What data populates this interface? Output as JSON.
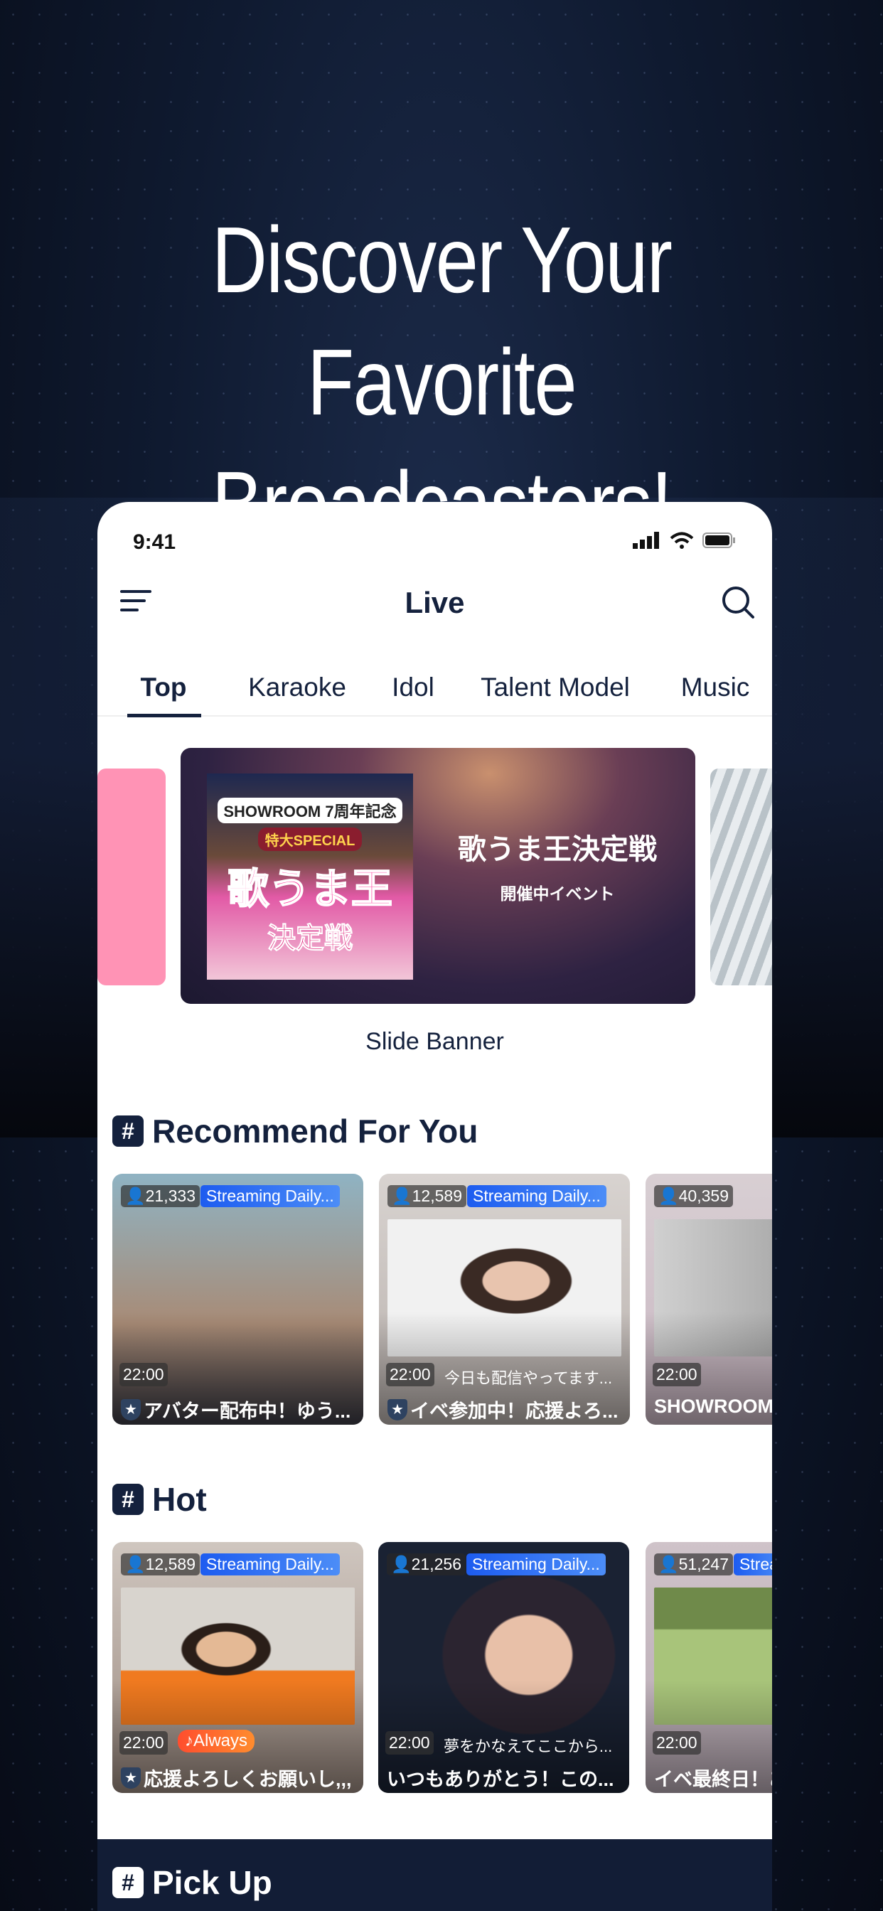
{
  "headline": {
    "line1": "Discover Your Favorite",
    "line2": "Broadcasters!"
  },
  "status": {
    "time": "9:41"
  },
  "nav": {
    "title": "Live",
    "menu_icon": "hamburger-icon",
    "search_icon": "search-icon"
  },
  "tabs": [
    {
      "label": "Top",
      "active": true
    },
    {
      "label": "Karaoke"
    },
    {
      "label": "Idol"
    },
    {
      "label": "Talent Model"
    },
    {
      "label": "Music"
    }
  ],
  "banner": {
    "poster_line1": "SHOWROOM 7周年記念",
    "poster_line2": "特大SPECIAL",
    "poster_line3": "歌うま王",
    "poster_line4": "決定戦",
    "title": "歌うま王決定戦",
    "subtitle": "開催中イベント",
    "label": "Slide Banner",
    "side_left_color": "#ff93b5"
  },
  "recommend": {
    "heading": "Recommend For You",
    "cards": [
      {
        "viewers": "21,333",
        "tag": "Streaming Daily...",
        "time": "22:00",
        "sub": "",
        "title": "アバター配布中！ゆう...",
        "star": true
      },
      {
        "viewers": "12,589",
        "tag": "Streaming Daily...",
        "time": "22:00",
        "sub": "今日も配信やってます...",
        "title": "イベ参加中！応援よろ...",
        "star": true
      },
      {
        "viewers": "40,359",
        "tag": "",
        "time": "22:00",
        "sub": "",
        "title": "SHOWROOM",
        "star": false
      }
    ]
  },
  "hot": {
    "heading": "Hot",
    "cards": [
      {
        "viewers": "12,589",
        "tag": "Streaming Daily...",
        "time": "22:00",
        "badge": "♪Always",
        "title": "応援よろしくお願いし,,,",
        "star": true
      },
      {
        "viewers": "21,256",
        "tag": "Streaming Daily...",
        "time": "22:00",
        "sub": "夢をかなえてここから...",
        "title": "いつもありがとう！この...",
        "star": false
      },
      {
        "viewers": "51,247",
        "tag": "Strea",
        "time": "22:00",
        "title": "イベ最終日！あ",
        "star": false
      }
    ]
  },
  "pickup": {
    "heading": "Pick Up"
  },
  "hash_symbol": "#"
}
